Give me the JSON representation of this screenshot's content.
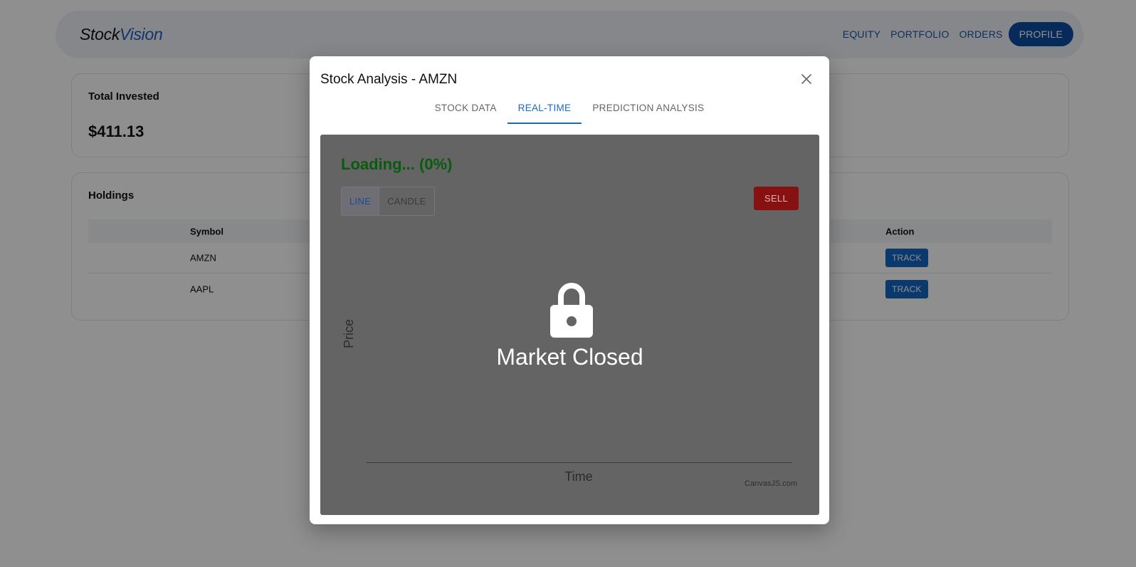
{
  "brand": {
    "part1": "Stock",
    "part2": "Vision"
  },
  "nav": {
    "links": [
      "EQUITY",
      "PORTFOLIO",
      "ORDERS"
    ],
    "profile": "PROFILE"
  },
  "invested": {
    "title": "Total Invested",
    "value": "$411.13"
  },
  "holdings": {
    "title": "Holdings",
    "columns": {
      "symbol": "Symbol",
      "action": "Action"
    },
    "rows": [
      {
        "symbol": "AMZN",
        "action": "TRACK"
      },
      {
        "symbol": "AAPL",
        "action": "TRACK"
      }
    ]
  },
  "modal": {
    "title": "Stock Analysis - AMZN",
    "tabs": [
      "STOCK DATA",
      "REAL-TIME",
      "PREDICTION ANALYSIS"
    ],
    "active_tab": "REAL-TIME",
    "loading": "Loading... (0%)",
    "toggle": {
      "line": "LINE",
      "candle": "CANDLE",
      "active": "LINE"
    },
    "sell": "SELL",
    "status": "Market Closed",
    "y_label": "Price",
    "x_label": "Time",
    "credit": "CanvasJS.com"
  },
  "colors": {
    "accent": "#1a6bc0",
    "profile_button": "#0b4ea3",
    "track_button": "#1467c5",
    "sell_button": "#871010",
    "loading_text": "#0a5a10"
  },
  "icons": {
    "close": "close-icon",
    "lock": "lock-icon"
  }
}
